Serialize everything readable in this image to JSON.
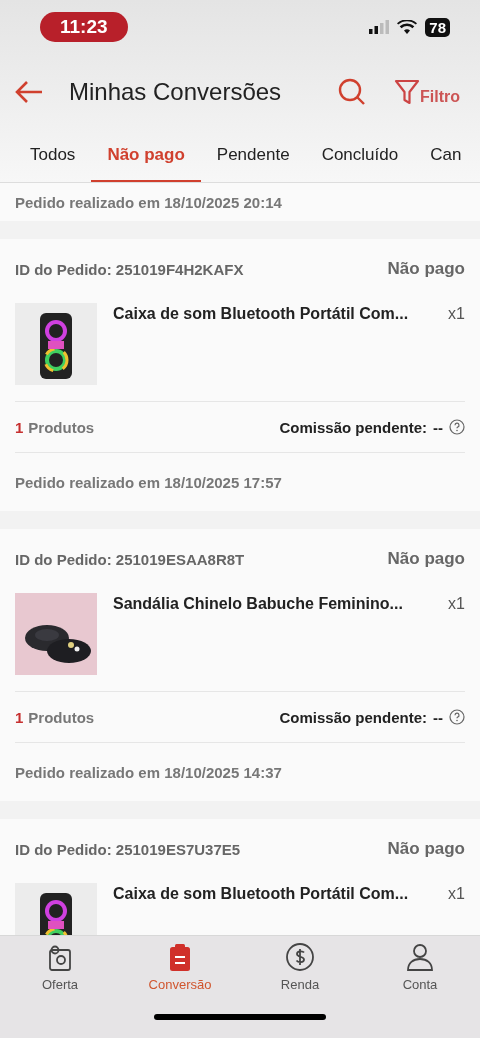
{
  "status_bar": {
    "time": "11:23",
    "battery": "78"
  },
  "header": {
    "title": "Minhas Conversões",
    "filter_label": "Filtro"
  },
  "tabs": [
    {
      "label": "Todos",
      "selected": false
    },
    {
      "label": "Não pago",
      "selected": true
    },
    {
      "label": "Pendente",
      "selected": false
    },
    {
      "label": "Concluído",
      "selected": false
    },
    {
      "label": "Can",
      "selected": false
    }
  ],
  "orders": [
    {
      "date": "Pedido realizado em 18/10/2025 20:14"
    },
    {
      "id": "ID do Pedido: 251019F4H2KAFX",
      "status": "Não pago",
      "product": "Caixa de som Bluetooth Portátil Com...",
      "quantity": "x1",
      "count": "1",
      "count_label": "Produtos",
      "commission_label": "Comissão pendente:",
      "commission_value": "--",
      "date": "Pedido realizado em 18/10/2025 17:57"
    },
    {
      "id": "ID do Pedido: 251019ESAA8R8T",
      "status": "Não pago",
      "product": "Sandália Chinelo Babuche Feminino...",
      "quantity": "x1",
      "count": "1",
      "count_label": "Produtos",
      "commission_label": "Comissão pendente:",
      "commission_value": "--",
      "date": "Pedido realizado em 18/10/2025 14:37"
    },
    {
      "id": "ID do Pedido: 251019ES7U37E5",
      "status": "Não pago",
      "product": "Caixa de som Bluetooth Portátil Com...",
      "quantity": "x1"
    }
  ],
  "bottom_nav": [
    {
      "label": "Oferta",
      "selected": false
    },
    {
      "label": "Conversão",
      "selected": true
    },
    {
      "label": "Renda",
      "selected": false
    },
    {
      "label": "Conta",
      "selected": false
    }
  ]
}
